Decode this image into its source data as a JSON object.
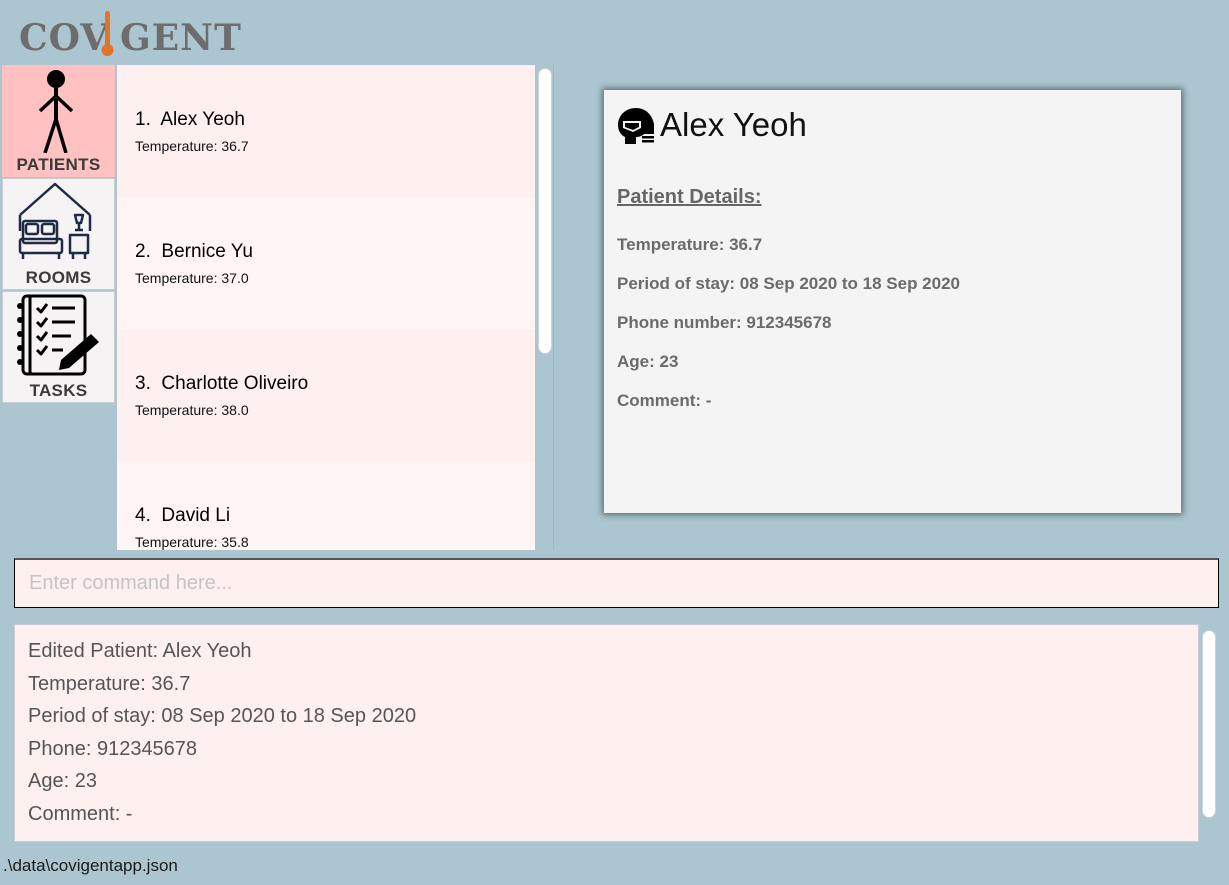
{
  "app": {
    "logo_left": "COV",
    "logo_right": "GENT"
  },
  "sidebar": {
    "tabs": [
      {
        "label": "PATIENTS",
        "icon": "person-icon",
        "active": true
      },
      {
        "label": "ROOMS",
        "icon": "bed-room-icon",
        "active": false
      },
      {
        "label": "TASKS",
        "icon": "task-checklist-icon",
        "active": false
      }
    ]
  },
  "patients": [
    {
      "index": "1.",
      "name": "Alex Yeoh",
      "temperature": "Temperature: 36.7"
    },
    {
      "index": "2.",
      "name": "Bernice Yu",
      "temperature": "Temperature: 37.0"
    },
    {
      "index": "3.",
      "name": "Charlotte Oliveiro",
      "temperature": "Temperature: 38.0"
    },
    {
      "index": "4.",
      "name": "David Li",
      "temperature": "Temperature: 35.8"
    }
  ],
  "detail": {
    "name": "Alex Yeoh",
    "heading": "Patient Details:",
    "temperature": "Temperature: 36.7",
    "period": "Period of stay: 08 Sep 2020 to 18 Sep 2020",
    "phone": "Phone number: 912345678",
    "age": "Age: 23",
    "comment": "Comment: -"
  },
  "command": {
    "placeholder": "Enter command here...",
    "value": ""
  },
  "result": {
    "lines": [
      "Edited Patient: Alex Yeoh",
      "Temperature: 36.7",
      "Period of stay: 08 Sep 2020 to 18 Sep 2020",
      "Phone: 912345678",
      "Age: 23",
      "Comment: -"
    ]
  },
  "status": {
    "file_path": ".\\data\\covigentapp.json"
  },
  "colors": {
    "background": "#abc6d0",
    "active_tab": "#ffc1c1",
    "card_pink": "#fff0f0",
    "thermometer": "#e0752a"
  }
}
